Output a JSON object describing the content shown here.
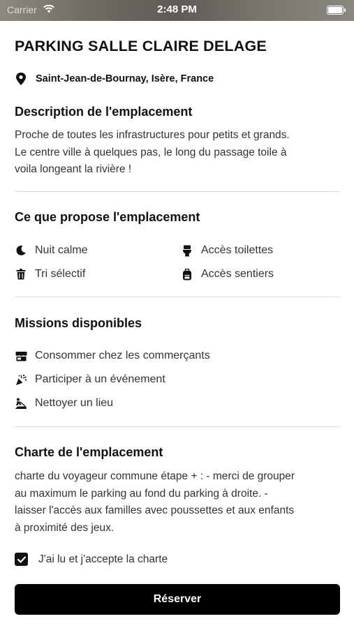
{
  "status_bar": {
    "carrier": "Carrier",
    "time": "2:48 PM"
  },
  "header": {
    "title": "PARKING SALLE CLAIRE DELAGE",
    "location": "Saint-Jean-de-Bournay, Isère, France"
  },
  "description": {
    "heading": "Description de l'emplacement",
    "lines": [
      "Proche de toutes les infrastructures pour petits et grands.",
      "Le centre ville à quelques pas, le long du passage toile à",
      "voila longeant la rivière !"
    ]
  },
  "amenities": {
    "heading": "Ce que propose l'emplacement",
    "items": [
      {
        "label": "Nuit calme",
        "icon": "moon-icon"
      },
      {
        "label": "Accès toilettes",
        "icon": "toilet-icon"
      },
      {
        "label": "Tri sélectif",
        "icon": "trash-icon"
      },
      {
        "label": "Accès sentiers",
        "icon": "backpack-icon"
      }
    ]
  },
  "missions": {
    "heading": "Missions disponibles",
    "items": [
      {
        "label": "Consommer chez les commerçants",
        "icon": "store-icon"
      },
      {
        "label": "Participer à un événement",
        "icon": "party-popper-icon"
      },
      {
        "label": "Nettoyer un lieu",
        "icon": "broom-icon"
      }
    ]
  },
  "charter": {
    "heading": "Charte de l'emplacement",
    "lines": [
      "charte du voyageur commune étape + : - merci de grouper",
      "au maximum le parking au fond du parking à droite. -",
      "laisser l'accès aux familles avec poussettes et aux enfants",
      "à proximité des jeux."
    ],
    "accept_label": "J'ai lu et j'accepte la charte",
    "accepted": true
  },
  "reserve_button": "Réserver"
}
